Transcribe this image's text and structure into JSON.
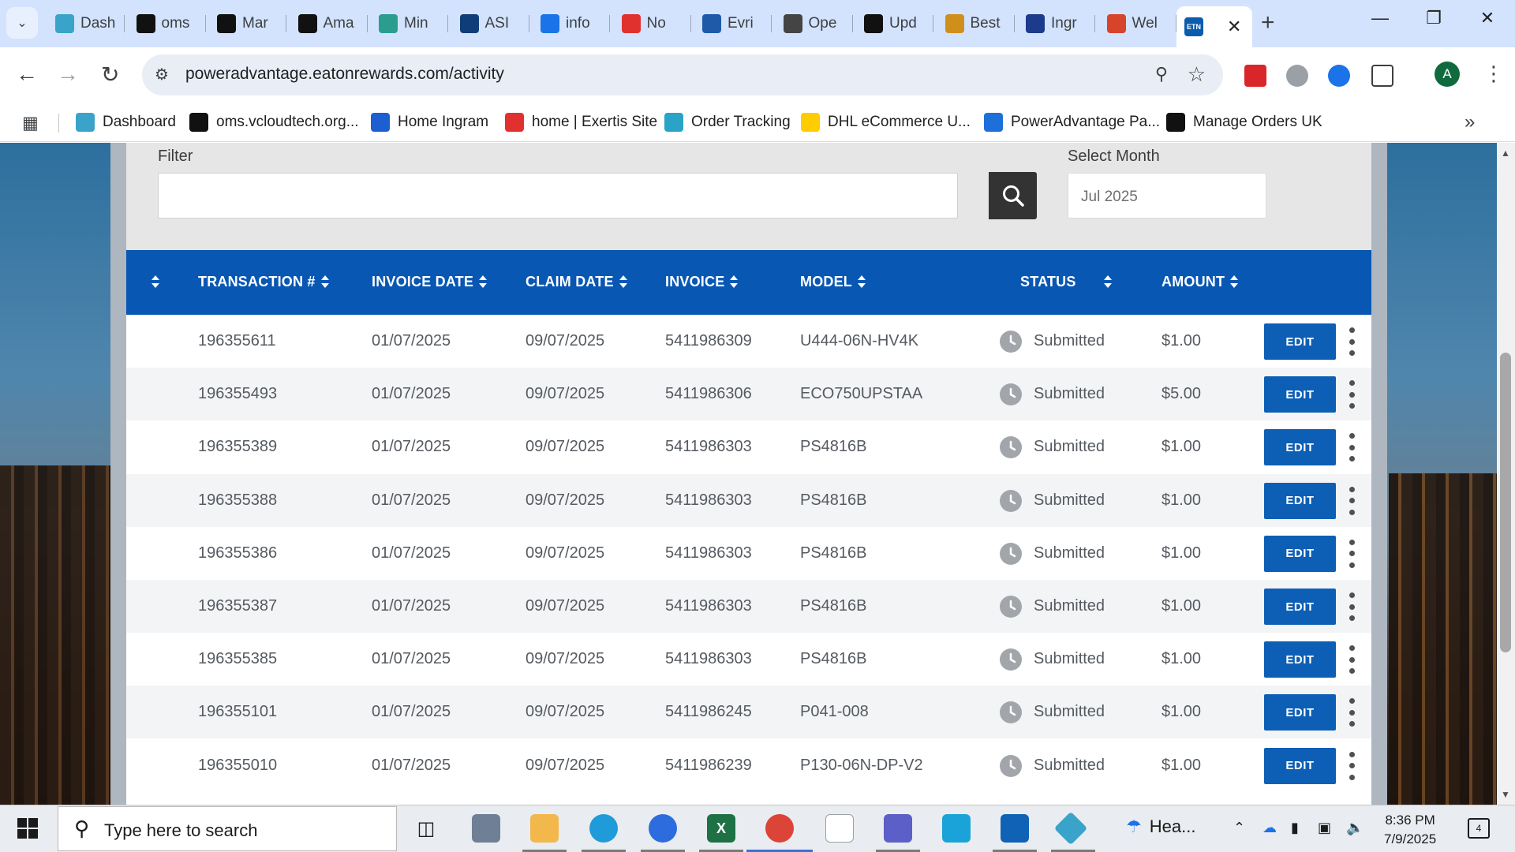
{
  "browser": {
    "tabs": [
      {
        "label": "Dash",
        "icon": "dashboard-favicon",
        "color": "#3aa3c9"
      },
      {
        "label": "oms",
        "icon": "oms-favicon",
        "color": "#111111"
      },
      {
        "label": "Mar",
        "icon": "amazon-favicon",
        "color": "#111111"
      },
      {
        "label": "Ama",
        "icon": "amazon-favicon",
        "color": "#111111"
      },
      {
        "label": "Min",
        "icon": "min-favicon",
        "color": "#2a9d8f"
      },
      {
        "label": "ASI",
        "icon": "asi-favicon",
        "color": "#0f3d7a"
      },
      {
        "label": "info",
        "icon": "info-favicon",
        "color": "#1a73e8"
      },
      {
        "label": "No",
        "icon": "exertis-favicon",
        "color": "#e0312f"
      },
      {
        "label": "Evri",
        "icon": "evri-favicon",
        "color": "#1e5aa8"
      },
      {
        "label": "Ope",
        "icon": "openai-favicon",
        "color": "#444444"
      },
      {
        "label": "Upd",
        "icon": "upd-favicon",
        "color": "#111111"
      },
      {
        "label": "Best",
        "icon": "bulb-favicon",
        "color": "#d08f1a"
      },
      {
        "label": "Ingr",
        "icon": "ingram-favicon",
        "color": "#1d3b8c"
      },
      {
        "label": "Wel",
        "icon": "wel-favicon",
        "color": "#d8432c"
      }
    ],
    "active_tab": {
      "icon_text": "ETN",
      "icon_color": "#0b5cad"
    },
    "url": "poweradvantage.eatonrewards.com/activity",
    "profile_initial": "A",
    "bookmarks": [
      {
        "label": "Dashboard",
        "color": "#3aa3c9"
      },
      {
        "label": "oms.vcloudtech.org...",
        "color": "#111111"
      },
      {
        "label": "Home Ingram",
        "color": "#1d5fd1"
      },
      {
        "label": "home | Exertis Site",
        "color": "#e0312f"
      },
      {
        "label": "Order Tracking",
        "color": "#2aa3c7"
      },
      {
        "label": "DHL eCommerce U...",
        "color": "#ffcc00"
      },
      {
        "label": "PowerAdvantage Pa...",
        "color": "#1e6fd9"
      },
      {
        "label": "Manage Orders UK",
        "color": "#111111"
      }
    ]
  },
  "filter": {
    "label": "Filter",
    "value": "",
    "month_label": "Select Month",
    "month_value": "Jul 2025"
  },
  "table": {
    "columns": [
      "",
      "Transaction #",
      "Invoice Date",
      "Claim Date",
      "Invoice",
      "Model",
      "Status",
      "Amount"
    ],
    "rows": [
      {
        "transaction": "196355611",
        "invoice_date": "01/07/2025",
        "claim_date": "09/07/2025",
        "invoice": "5411986309",
        "model": "U444-06N-HV4K",
        "status": "Submitted",
        "amount": "$1.00"
      },
      {
        "transaction": "196355493",
        "invoice_date": "01/07/2025",
        "claim_date": "09/07/2025",
        "invoice": "5411986306",
        "model": "ECO750UPSTAA",
        "status": "Submitted",
        "amount": "$5.00"
      },
      {
        "transaction": "196355389",
        "invoice_date": "01/07/2025",
        "claim_date": "09/07/2025",
        "invoice": "5411986303",
        "model": "PS4816B",
        "status": "Submitted",
        "amount": "$1.00"
      },
      {
        "transaction": "196355388",
        "invoice_date": "01/07/2025",
        "claim_date": "09/07/2025",
        "invoice": "5411986303",
        "model": "PS4816B",
        "status": "Submitted",
        "amount": "$1.00"
      },
      {
        "transaction": "196355386",
        "invoice_date": "01/07/2025",
        "claim_date": "09/07/2025",
        "invoice": "5411986303",
        "model": "PS4816B",
        "status": "Submitted",
        "amount": "$1.00"
      },
      {
        "transaction": "196355387",
        "invoice_date": "01/07/2025",
        "claim_date": "09/07/2025",
        "invoice": "5411986303",
        "model": "PS4816B",
        "status": "Submitted",
        "amount": "$1.00"
      },
      {
        "transaction": "196355385",
        "invoice_date": "01/07/2025",
        "claim_date": "09/07/2025",
        "invoice": "5411986303",
        "model": "PS4816B",
        "status": "Submitted",
        "amount": "$1.00"
      },
      {
        "transaction": "196355101",
        "invoice_date": "01/07/2025",
        "claim_date": "09/07/2025",
        "invoice": "5411986245",
        "model": "P041-008",
        "status": "Submitted",
        "amount": "$1.00"
      },
      {
        "transaction": "196355010",
        "invoice_date": "01/07/2025",
        "claim_date": "09/07/2025",
        "invoice": "5411986239",
        "model": "P130-06N-DP-V2",
        "status": "Submitted",
        "amount": "$1.00"
      }
    ],
    "edit_label": "EDIT"
  },
  "taskbar": {
    "search_placeholder": "Type here to search",
    "weather": "Hea...",
    "time": "8:36 PM",
    "date": "7/9/2025",
    "notifications": "4"
  },
  "colors": {
    "header_blue": "#0857b3",
    "edit_button": "#0d5fb5",
    "tab_strip": "#d3e3fd"
  }
}
